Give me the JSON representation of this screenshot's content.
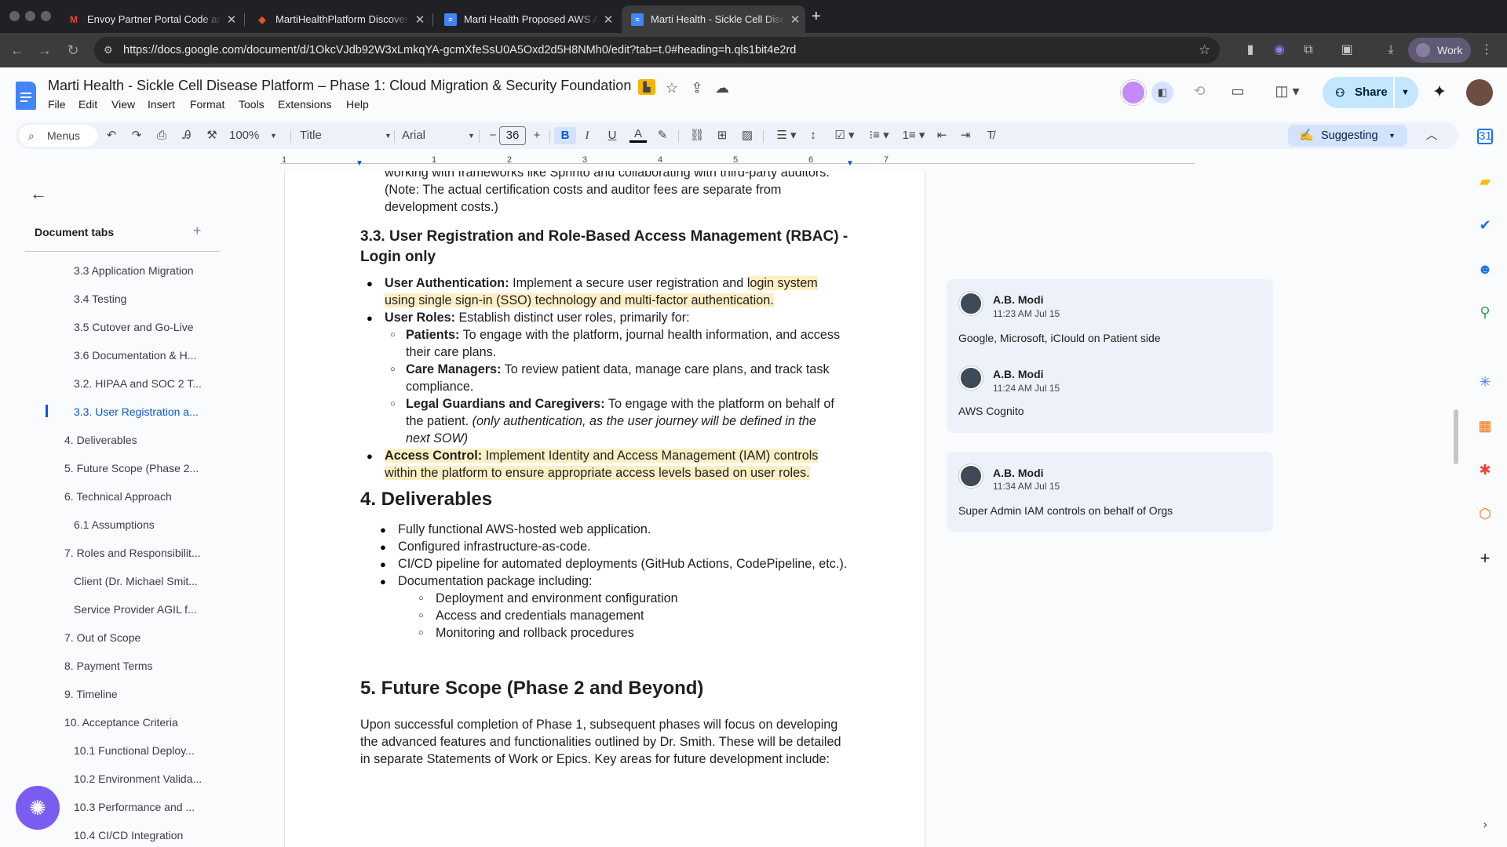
{
  "browser": {
    "tabs": [
      {
        "title": "Envoy Partner Portal Code and",
        "icon": "gmail-icon"
      },
      {
        "title": "MartiHealthPlatform Discovery",
        "icon": "figma-icon"
      },
      {
        "title": "Marti Health Proposed AWS A",
        "icon": "docs-icon"
      },
      {
        "title": "Marti Health - Sickle Cell Disease",
        "icon": "docs-icon"
      }
    ],
    "url": "https://docs.google.com/document/d/1OkcVJdb92W3xLmkqYA-gcmXfeSsU0A5Oxd2d5H8NMh0/edit?tab=t.0#heading=h.qls1bit4e2rd",
    "profile_label": "Work"
  },
  "doc": {
    "title": "Marti Health - Sickle Cell Disease Platform – Phase 1: Cloud Migration & Security Foundation",
    "menus": [
      "File",
      "Edit",
      "View",
      "Insert",
      "Format",
      "Tools",
      "Extensions",
      "Help"
    ],
    "share_label": "Share"
  },
  "toolbar": {
    "menus_label": "Menus",
    "zoom": "100%",
    "style": "Title",
    "font": "Arial",
    "font_size": "36",
    "mode": "Suggesting"
  },
  "ruler": {
    "marks": [
      "1",
      "1",
      "2",
      "3",
      "4",
      "5",
      "6",
      "7"
    ]
  },
  "outline": {
    "header": "Document tabs",
    "items": [
      "3.3 Application Migration",
      "3.4 Testing",
      "3.5 Cutover and Go-Live",
      "3.6 Documentation & H...",
      "3.2. HIPAA and SOC 2 T...",
      "3.3. User Registration a...",
      "4. Deliverables",
      "5. Future Scope (Phase 2...",
      "6. Technical Approach",
      "6.1 Assumptions",
      "7. Roles and Responsibilit...",
      "Client (Dr. Michael Smit...",
      "Service Provider AGIL f...",
      "7. Out of Scope",
      "8. Payment Terms",
      "9. Timeline",
      "10. Acceptance Criteria",
      "10.1 Functional Deploy...",
      "10.2 Environment Valida...",
      "10.3 Performance and ...",
      "10.4 CI/CD Integration"
    ]
  },
  "content": {
    "top_cut": "working with frameworks like Sprinto and collaborating with third-party auditors.",
    "top_l2": "(Note: The actual certification costs and auditor fees are separate from",
    "top_l3": "development costs.)",
    "h33_l1": "3.3. User Registration and Role-Based Access Management (RBAC) -",
    "h33_l2": "Login only",
    "ua_label": "User Authentication:",
    "ua_text1": " Implement a secure user registration and ",
    "ua_hl1": "login system",
    "ua_hl2": "using single sign-in (SSO) technology and multi-factor authentication.",
    "ur_label": "User Roles:",
    "ur_text": " Establish distinct user roles, primarily for:",
    "pt_label": "Patients:",
    "pt_text": " To engage with the platform, journal health information, and access",
    "pt_l2": "their care plans.",
    "cm_label": "Care Managers:",
    "cm_text": " To review patient data, manage care plans, and track task",
    "cm_l2": "compliance.",
    "lg_label": "Legal Guardians and Caregivers:",
    "lg_text": " To engage with the platform on behalf of",
    "lg_l2a": "the patient. ",
    "lg_l2b": "(only authentication, as the user journey will be defined in the",
    "lg_l3": "next SOW)",
    "ac_label": "Access Control:",
    "ac_text": " Implement Identity and Access Management (IAM) controls",
    "ac_l2": "within the platform to ensure appropriate access levels based on user roles.",
    "h4": "4. Deliverables",
    "d1": "Fully functional AWS-hosted web application.",
    "d2": "Configured infrastructure-as-code.",
    "d3": "CI/CD pipeline for automated deployments (GitHub Actions, CodePipeline, etc.).",
    "d4": "Documentation package including:",
    "d4a": "Deployment and environment configuration",
    "d4b": "Access and credentials management",
    "d4c": "Monitoring and rollback procedures",
    "h5": "5. Future Scope (Phase 2 and Beyond)",
    "p5_l1": "Upon successful completion of Phase 1, subsequent phases will focus on developing",
    "p5_l2": "the advanced features and functionalities outlined by Dr. Smith. These will be detailed",
    "p5_l3": "in separate Statements of Work or Epics. Key areas for future development include:"
  },
  "comments": [
    {
      "author": "A.B. Modi",
      "time": "11:23 AM Jul 15",
      "text": "Google, Microsoft, iCIould on Patient side"
    },
    {
      "author": "A.B. Modi",
      "time": "11:24 AM Jul 15",
      "text": "AWS Cognito"
    },
    {
      "author": "A.B. Modi",
      "time": "11:34 AM Jul 15",
      "text": "Super Admin IAM controls on behalf of Orgs"
    }
  ],
  "colors": {
    "accent": "#0b57d0",
    "share_bg": "#c2e7ff",
    "highlight": "#fdefc3",
    "suggest_bg": "#d3e3fd"
  }
}
